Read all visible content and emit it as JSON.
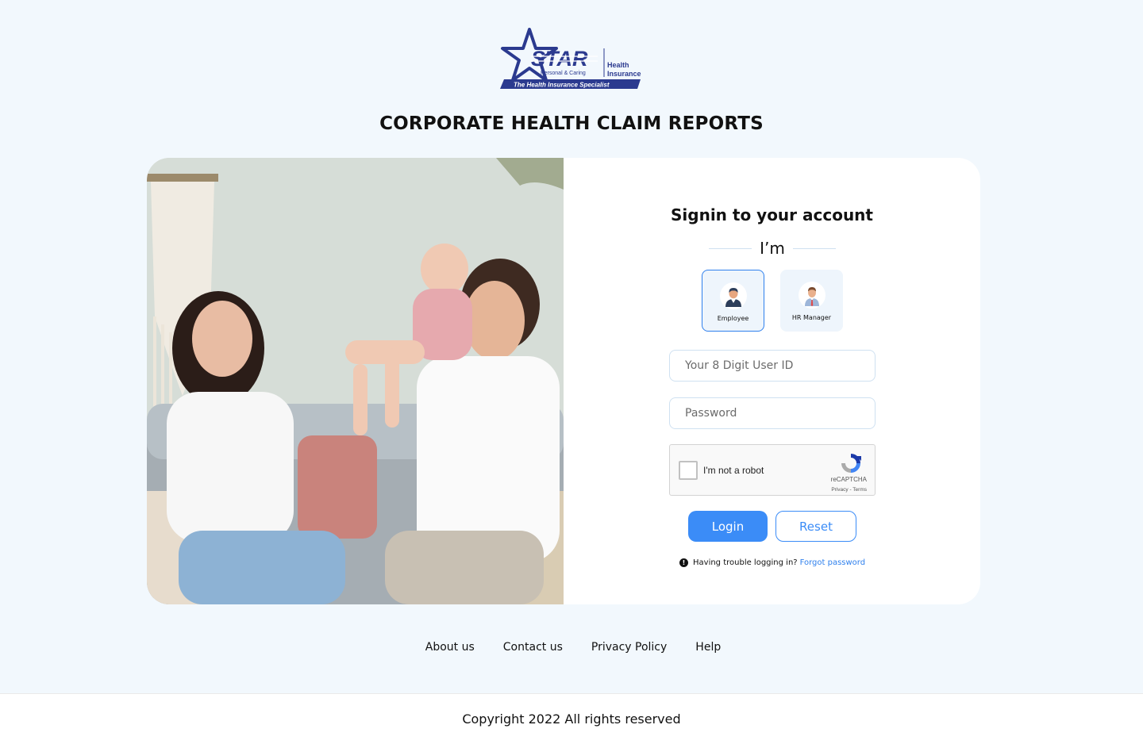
{
  "brand": {
    "wordmark": "STAR",
    "tagline_small": "Personal & Caring",
    "product_line1": "Health",
    "product_line2": "Insurance",
    "ribbon": "The Health Insurance Specialist",
    "color_primary": "#2b3a8f"
  },
  "page": {
    "title": "CORPORATE HEALTH CLAIM REPORTS"
  },
  "signin": {
    "title": "Signin to your account",
    "role_prompt": "I’m",
    "roles": [
      {
        "label": "Employee",
        "icon": "employee-avatar-icon",
        "selected": true
      },
      {
        "label": "HR Manager",
        "icon": "hr-manager-avatar-icon",
        "selected": false
      }
    ],
    "user_id_placeholder": "Your 8 Digit User ID",
    "password_placeholder": "Password",
    "captcha": {
      "label": "I'm not a robot",
      "brand": "reCAPTCHA",
      "links": "Privacy - Terms"
    },
    "login_label": "Login",
    "reset_label": "Reset",
    "trouble_text": "Having trouble logging in?",
    "forgot_label": "Forgot password"
  },
  "footer": {
    "links": [
      "About us",
      "Contact us",
      "Privacy Policy",
      "Help"
    ],
    "copyright": "Copyright 2022 All rights reserved"
  },
  "colors": {
    "accent": "#3b8cf7",
    "background": "#f2f8fd"
  }
}
